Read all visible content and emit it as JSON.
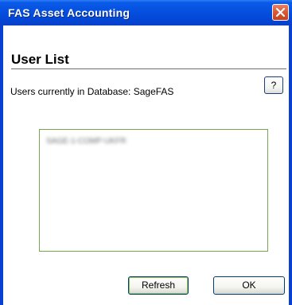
{
  "window": {
    "title": "FAS Asset Accounting"
  },
  "dialog": {
    "heading": "User List",
    "users_label": "Users currently in Database: SageFAS",
    "help_label": "?",
    "users": [
      "SAGE-1-COMP-UKFR"
    ],
    "refresh_label": "Refresh",
    "ok_label": "OK"
  },
  "icons": {
    "close": "close-icon"
  },
  "colors": {
    "titlebar": "#0550df",
    "listbox_border": "#7aa552",
    "close_button": "#dc5a36"
  }
}
